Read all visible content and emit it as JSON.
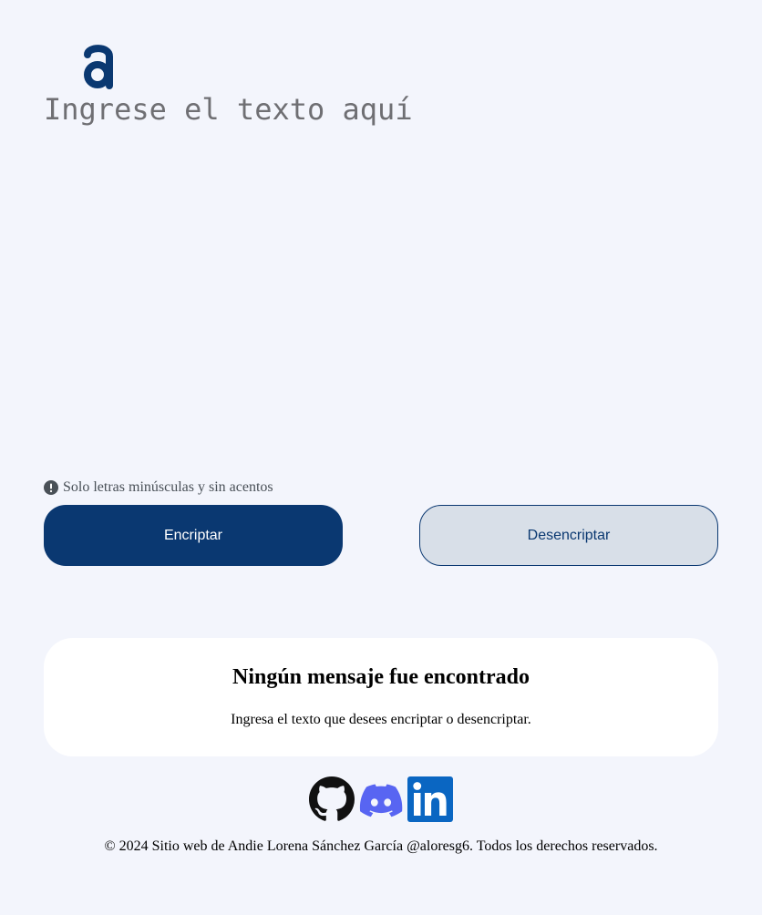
{
  "logo": {
    "icon": "alura-a-logo",
    "color": "#0a3871"
  },
  "input": {
    "placeholder": "Ingrese el texto aquí",
    "value": ""
  },
  "hint": {
    "icon": "exclamation-circle-icon",
    "text": "Solo letras minúsculas y sin acentos"
  },
  "buttons": {
    "encrypt_label": "Encriptar",
    "decrypt_label": "Desencriptar"
  },
  "result": {
    "title": "Ningún mensaje fue encontrado",
    "text": "Ingresa el texto que desees encriptar o desencriptar."
  },
  "social": [
    {
      "name": "github-icon"
    },
    {
      "name": "discord-icon"
    },
    {
      "name": "linkedin-icon"
    }
  ],
  "footer": {
    "text": "© 2024 Sitio web de Andie Lorena Sánchez García @aloresg6. Todos los derechos reservados."
  },
  "colors": {
    "background": "#f3f5fc",
    "primary": "#0a3871",
    "secondary_bg": "#d8dfe8",
    "card": "#ffffff",
    "discord": "#5865f2",
    "linkedin": "#0a66c2"
  }
}
